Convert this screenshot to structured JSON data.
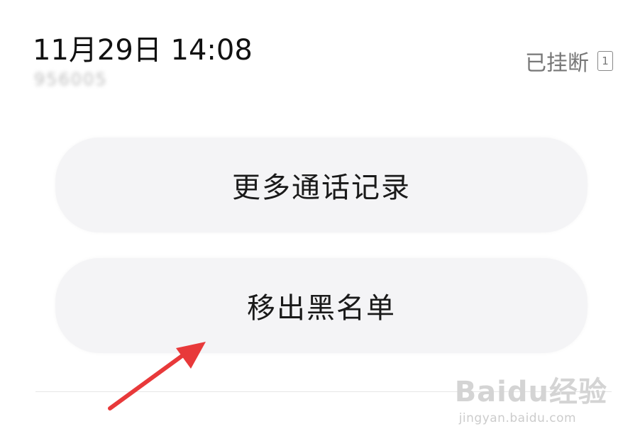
{
  "call": {
    "datetime": "11月29日 14:08",
    "number": "956005",
    "status": "已挂断",
    "sim_slot": "1"
  },
  "actions": {
    "more_records": "更多通话记录",
    "remove_blacklist": "移出黑名单"
  },
  "watermark": {
    "brand": "Baidu经验",
    "sub": "jingyan.baidu.com"
  },
  "colors": {
    "arrow": "#e8393a",
    "button_bg": "#f4f4f6"
  }
}
